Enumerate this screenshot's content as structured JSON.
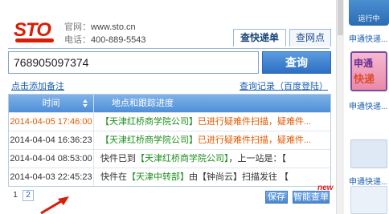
{
  "brand": {
    "logo_text": "STO",
    "website_label": "官网：",
    "website": "www.sto.cn",
    "phone_label": "电话：",
    "phone": "400-889-5543"
  },
  "tabs": [
    {
      "label": "查快递单",
      "active": true
    },
    {
      "label": "查网点",
      "active": false
    }
  ],
  "search": {
    "value": "768905097374",
    "button_label": "查询"
  },
  "links": {
    "add_note": "点击添加备注",
    "history": "查询记录（百度登陆）"
  },
  "table": {
    "headers": {
      "time": "时间",
      "desc": "地点和跟踪进度"
    },
    "rows": [
      {
        "time": "2014-04-05 17:46:00",
        "pre": "",
        "place": "【天津红桥商学院公司】",
        "post": "已进行疑难件扫描，疑难件..."
      },
      {
        "time": "2014-04-04 16:36:23",
        "pre": "",
        "place": "【天津红桥商学院公司】",
        "post": "已进行疑难件扫描，疑难件..."
      },
      {
        "time": "2014-04-04 08:53:00",
        "pre": "快件已到",
        "place": "【天津红桥商学院公司】",
        "post": "，上一站是：【"
      },
      {
        "time": "2014-04-03 22:45:23",
        "pre": "快件在",
        "place": "【天津中转部】",
        "post": "由【钟尚云】扫描发往 【"
      }
    ]
  },
  "pager": {
    "current": "1",
    "other": "2"
  },
  "actions": {
    "save": "保存",
    "smart": "智能查单",
    "badge": "new"
  },
  "sidebar": {
    "card1_text": "运行中",
    "link1": "申通快递...",
    "card2_line1": "申通",
    "card2_line2": "快递",
    "link2": "申通快递...",
    "link3": "申通快递..."
  },
  "colors": {
    "accent": "#2d6fc3",
    "brand_red": "#d81e06",
    "highlight": "#e05a00",
    "place_green": "#1f8f1f"
  }
}
